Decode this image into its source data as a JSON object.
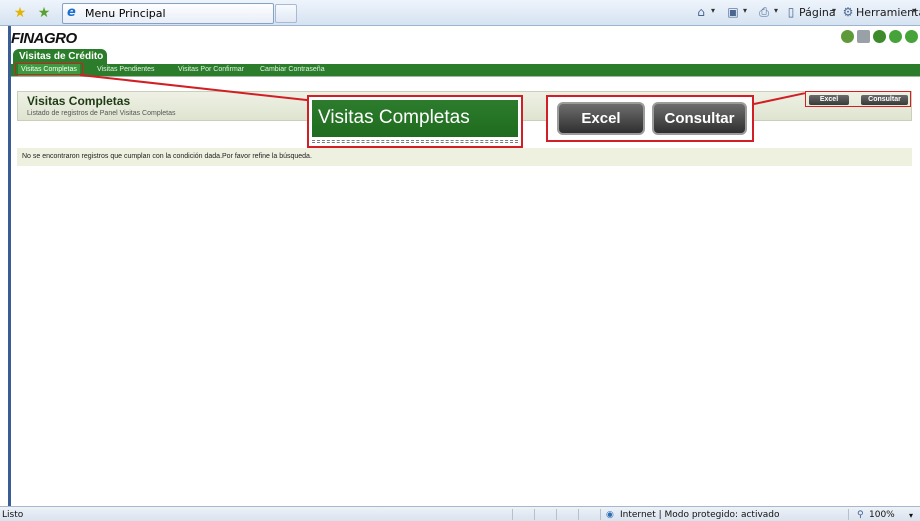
{
  "browser": {
    "tab_title": "Menu Principal",
    "page_menu_label": "Página",
    "tools_menu_label": "Herramientas",
    "dropdown_glyph": "▾"
  },
  "app": {
    "brand": "FINAGRO",
    "module_tab": "Visitas de Crédito",
    "nav_items": [
      {
        "label": "Visitas Completas",
        "active": true
      },
      {
        "label": "Visitas Pendientes",
        "active": false
      },
      {
        "label": "Visitas Por Confirmar",
        "active": false
      },
      {
        "label": "Cambiar Contraseña",
        "active": false
      }
    ]
  },
  "panel": {
    "title": "Visitas Completas",
    "subtitle": "Listado de registros de Panel Visitas Completas",
    "excel_label": "Excel",
    "consultar_label": "Consultar",
    "empty_message": "No se encontraron registros que cumplan con la condición dada.Por favor refine la búsqueda."
  },
  "callouts": {
    "title_zoom": "Visitas Completas",
    "excel_zoom": "Excel",
    "consultar_zoom": "Consultar"
  },
  "status": {
    "left_text": "Listo",
    "zone_text": "Internet | Modo protegido: activado",
    "zoom_text": "100%"
  },
  "colors": {
    "app_green": "#2b7d2b",
    "callout_red": "#d21f25",
    "browser_blue": "#3a5d95"
  }
}
